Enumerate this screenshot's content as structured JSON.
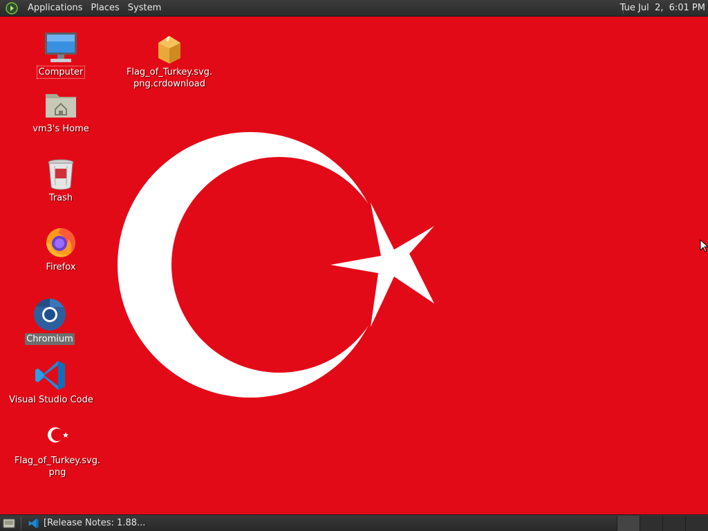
{
  "top_panel": {
    "menus": [
      "Applications",
      "Places",
      "System"
    ],
    "clock": "Tue Jul  2,  6:01 PM"
  },
  "desktop": {
    "wallpaper_colors": {
      "red": "#e30a17",
      "white": "#ffffff"
    },
    "icons": [
      {
        "label": "Computer",
        "icon": "computer-icon"
      },
      {
        "label": "vm3's Home",
        "icon": "home-folder-icon"
      },
      {
        "label": "Trash",
        "icon": "trash-icon"
      },
      {
        "label": "Firefox",
        "icon": "firefox-icon"
      },
      {
        "label": "Chromium",
        "icon": "chromium-icon"
      },
      {
        "label": "Visual Studio Code",
        "icon": "vscode-icon"
      },
      {
        "label_line1": "Flag_of_Turkey.svg.",
        "label_line2": "png",
        "icon": "turkey-flag-thumbnail-icon"
      },
      {
        "label_line1": "Flag_of_Turkey.svg.",
        "label_line2": "png.crdownload",
        "icon": "package-icon"
      }
    ]
  },
  "bottom_panel": {
    "task": {
      "label": "[Release Notes: 1.88...",
      "icon": "vscode-icon"
    },
    "workspace_count": 4
  }
}
